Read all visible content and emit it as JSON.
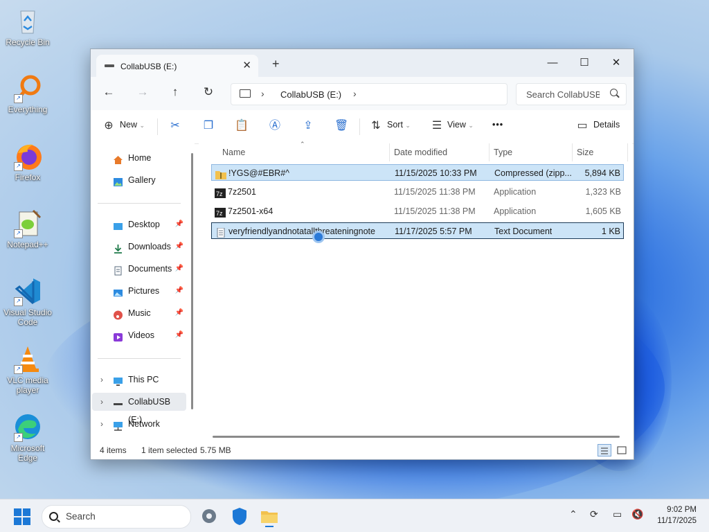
{
  "desktop": {
    "icons": [
      {
        "label": "Recycle Bin",
        "icon": "recycle-bin-icon"
      },
      {
        "label": "Everything",
        "icon": "everything-search-icon"
      },
      {
        "label": "Firefox",
        "icon": "firefox-icon"
      },
      {
        "label": "Notepad++",
        "icon": "notepad-plus-plus-icon"
      },
      {
        "label": "Visual Studio Code",
        "icon": "vscode-icon"
      },
      {
        "label": "VLC media player",
        "icon": "vlc-icon"
      },
      {
        "label": "Microsoft Edge",
        "icon": "edge-icon"
      }
    ]
  },
  "window": {
    "tab_title": "CollabUSB (E:)",
    "new_tab": "+",
    "controls": {
      "minimize": "—",
      "maximize": "☐",
      "close": "✕"
    },
    "address": {
      "crumb": "CollabUSB (E:)",
      "separator": "›"
    },
    "search": {
      "placeholder": "Search CollabUSB (E:)"
    },
    "toolbar": {
      "new": "New",
      "sort": "Sort",
      "view": "View",
      "more": "•••",
      "details": "Details"
    },
    "nav": {
      "home": "Home",
      "gallery": "Gallery",
      "desktop": "Desktop",
      "downloads": "Downloads",
      "documents": "Documents",
      "pictures": "Pictures",
      "music": "Music",
      "videos": "Videos",
      "this_pc": "This PC",
      "collabusb": "CollabUSB (E:)",
      "network": "Network"
    },
    "columns": {
      "name": "Name",
      "date": "Date modified",
      "type": "Type",
      "size": "Size"
    },
    "files": [
      {
        "name": "!YGS@#EBR#^",
        "date": "11/15/2025 10:33 PM",
        "type": "Compressed (zipp...",
        "size": "5,894 KB",
        "icon": "zip-folder-icon",
        "selected": true
      },
      {
        "name": "7z2501",
        "date": "11/15/2025 11:38 PM",
        "type": "Application",
        "size": "1,323 KB",
        "icon": "7zip-icon",
        "selected": false
      },
      {
        "name": "7z2501-x64",
        "date": "11/15/2025 11:38 PM",
        "type": "Application",
        "size": "1,605 KB",
        "icon": "7zip-icon",
        "selected": false
      },
      {
        "name": "veryfriendlyandnotatallthreateningnote",
        "date": "11/17/2025 5:57 PM",
        "type": "Text Document",
        "size": "1 KB",
        "icon": "text-file-icon",
        "selected": true
      }
    ],
    "status": {
      "items": "4 items",
      "selected": "1 item selected",
      "size": "5.75 MB"
    }
  },
  "taskbar": {
    "search": "Search",
    "time": "9:02 PM",
    "date": "11/17/2025"
  },
  "colors": {
    "accent": "#1c78d6",
    "selection": "#cce4f7",
    "window_chrome": "#e9eef4"
  }
}
